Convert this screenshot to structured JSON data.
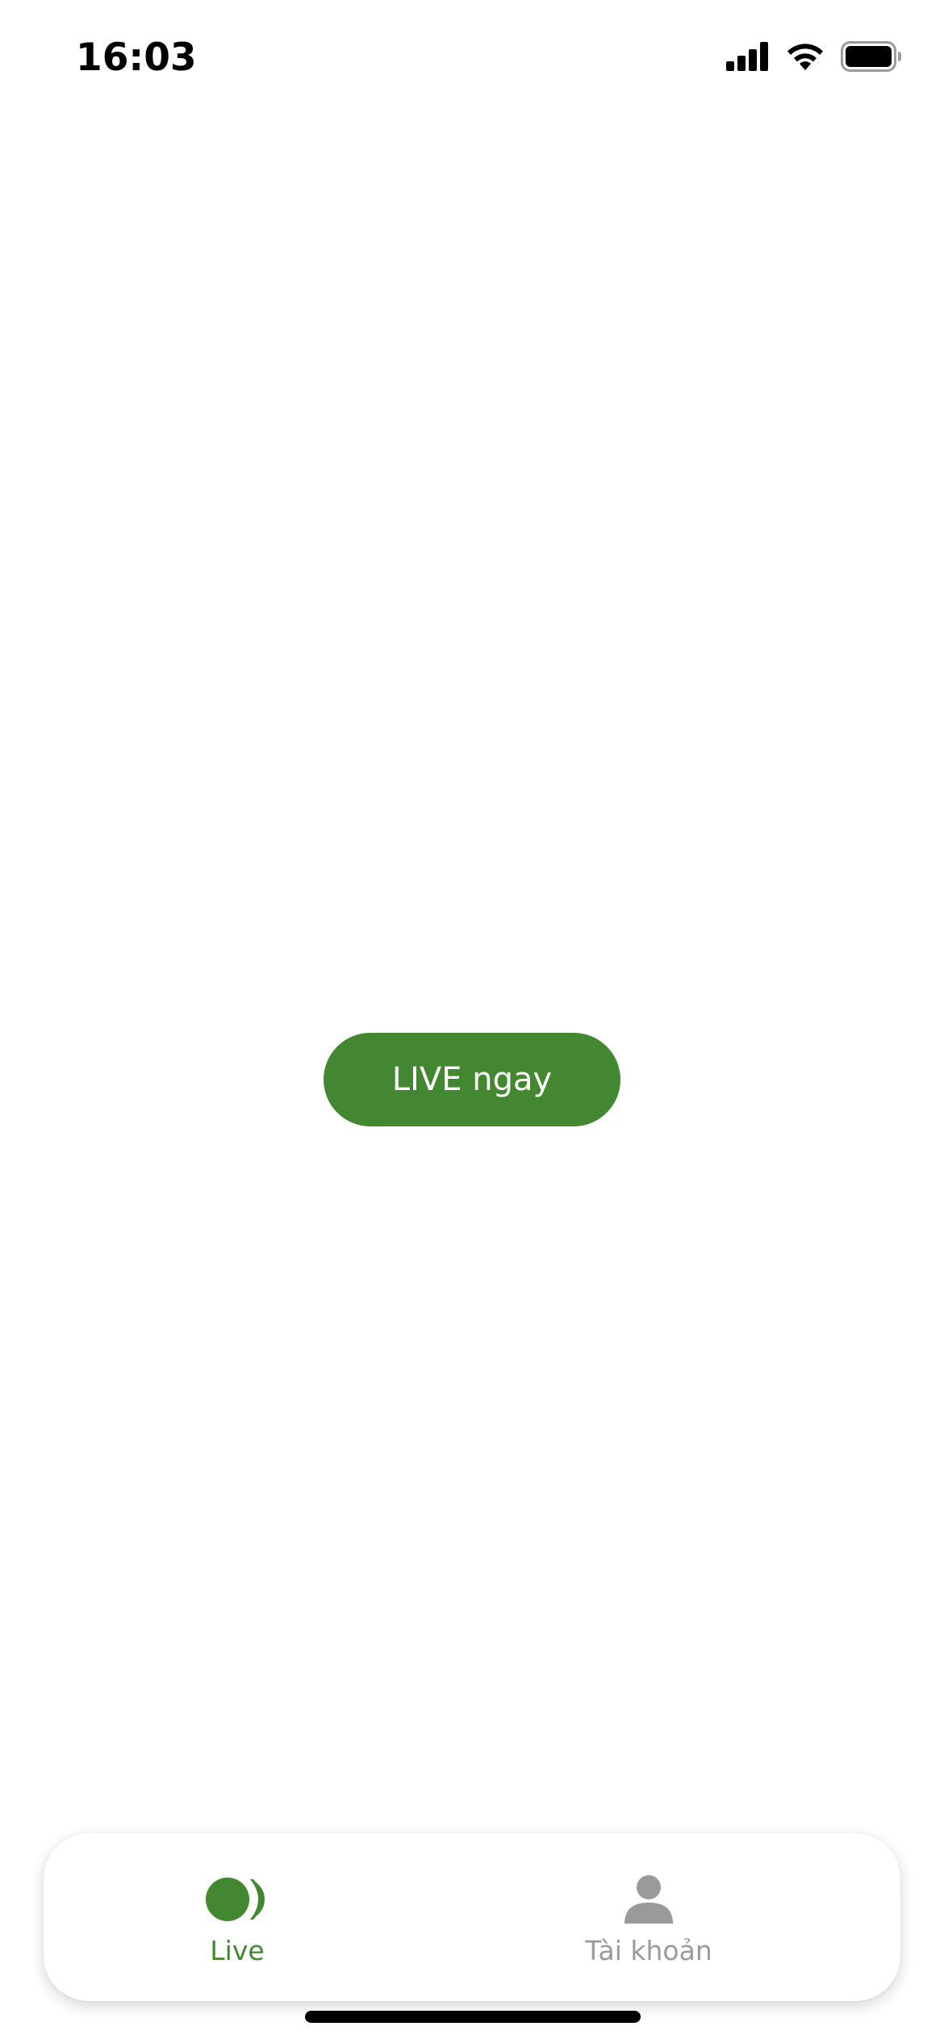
{
  "status_bar": {
    "time": "16:03",
    "icons": [
      "cellular-signal-icon",
      "wifi-icon",
      "battery-icon"
    ]
  },
  "main": {
    "live_button_label": "LIVE ngay"
  },
  "tab_bar": {
    "tabs": [
      {
        "label": "Live",
        "icon": "live-icon",
        "active": true
      },
      {
        "label": "Tài khoản",
        "icon": "person-icon",
        "active": false
      }
    ]
  },
  "colors": {
    "accent": "#438830",
    "inactive": "#9a9a9a",
    "background": "#ffffff"
  }
}
